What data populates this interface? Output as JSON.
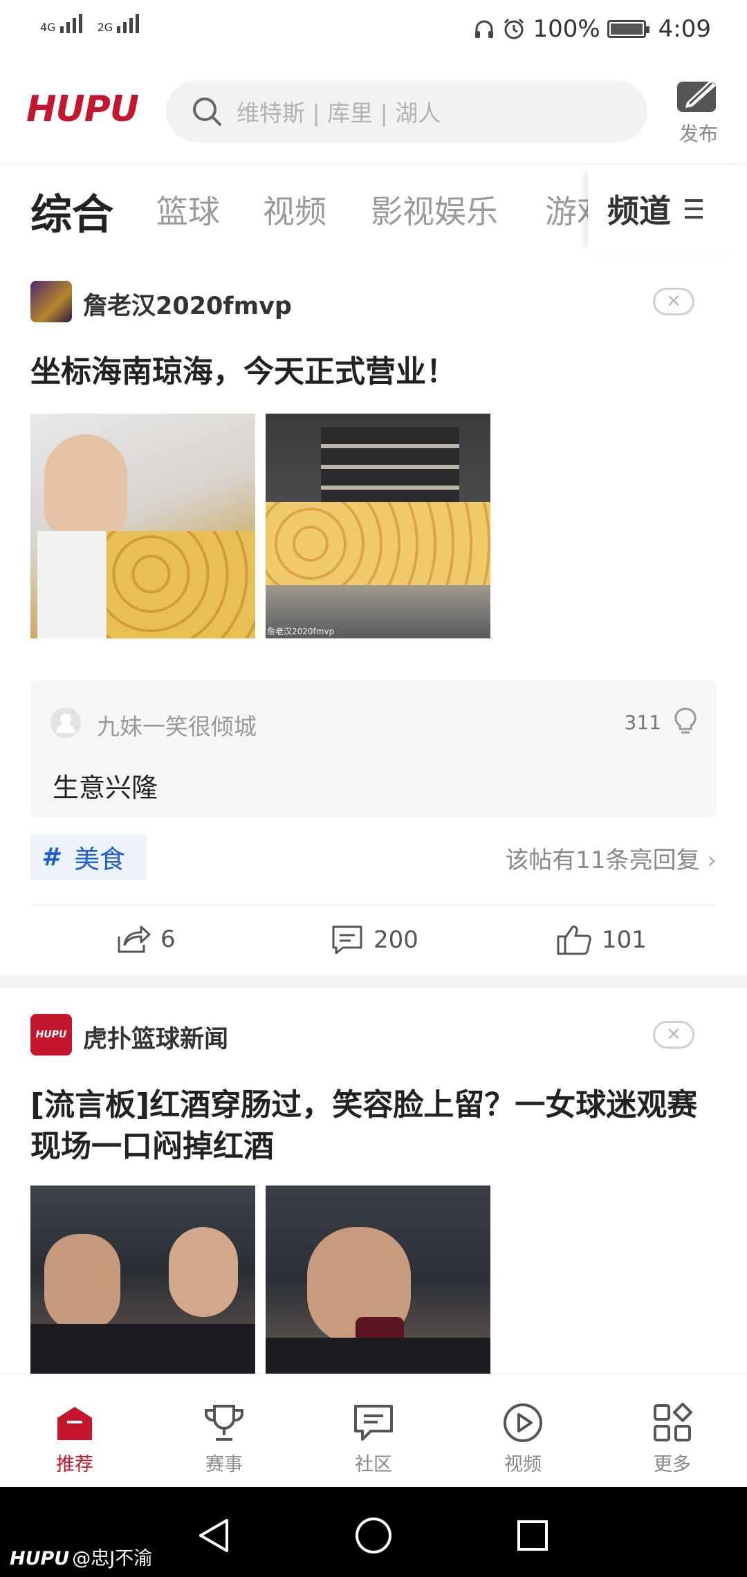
{
  "status_bar": {
    "network1": "4G",
    "network2": "2G",
    "battery": "100%",
    "time": "4:09"
  },
  "header": {
    "logo": "HUPU",
    "search_placeholder": "维特斯 | 库里 | 湖人",
    "publish_label": "发布"
  },
  "tabs": {
    "items": [
      "综合",
      "篮球",
      "视频",
      "影视娱乐",
      "游戏"
    ],
    "active_index": 0,
    "channel_label": "频道"
  },
  "posts": [
    {
      "author": "詹老汉2020fmvp",
      "title": "坐标海南琼海，今天正式营业！",
      "image_watermark": "詹老汉2020fmvp",
      "hot_comment": {
        "user": "九妹一笑很倾城",
        "likes": "311",
        "text": "生意兴隆"
      },
      "tag": "美食",
      "bright_replies": "该帖有11条亮回复",
      "stats": {
        "shares": "6",
        "comments": "200",
        "likes": "101"
      }
    },
    {
      "author": "虎扑篮球新闻",
      "avatar_text": "HUPU",
      "title": "[流言板]红酒穿肠过，笑容脸上留？一女球迷观赛现场一口闷掉红酒"
    }
  ],
  "bottom_nav": {
    "items": [
      "推荐",
      "赛事",
      "社区",
      "视频",
      "更多"
    ],
    "active_index": 0
  },
  "watermark": {
    "logo": "HUPU",
    "user": "@忠J不渝"
  },
  "colors": {
    "brand": "#c4162d",
    "tag_blue": "#1f5fd1"
  }
}
